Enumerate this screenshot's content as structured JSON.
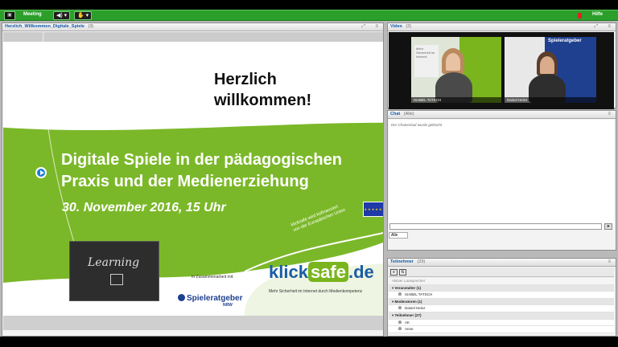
{
  "menubar": {
    "menu_label": "Meeting",
    "help_label": "Hilfe"
  },
  "presentation": {
    "title": "Herzlich_Willkommen_Digitale_Spiele",
    "count": "(3)",
    "slide": {
      "welcome_line1": "Herzlich",
      "welcome_line2": "willkommen!",
      "title_line1": "Digitale Spiele in der pädagogischen",
      "title_line2": "Praxis und der Medienerziehung",
      "date": "30. November 2016, 15 Uhr",
      "eu_line1": "klicksafe wird kofinanziert",
      "eu_line2": "von der Europäischen Union",
      "board_word": "Learning",
      "cooperation": "In Zusammenarbeit mit:",
      "partner_name": "Spieleratgeber",
      "partner_region": "NRW",
      "logo_klick": "klick",
      "logo_safe": "safe",
      "logo_de": ".de",
      "logo_tagline": "Mehr Sicherheit im Internet durch Medienkompetenz"
    }
  },
  "video": {
    "title": "Video",
    "count": "(2)",
    "feeds": [
      {
        "name": "ISABEL TATSCH"
      },
      {
        "name": "Daniel Heinz"
      }
    ],
    "banner_text": "Spieleratgeber"
  },
  "chat": {
    "title": "Chat",
    "scope": "(Alle)",
    "messages": [
      "Der Chatverlauf wurde gelöscht"
    ],
    "tab_label": "Alle"
  },
  "participants": {
    "title": "Teilnehmer",
    "count": "(29)",
    "hint": "Aktiver Lautsprecher",
    "groups": [
      {
        "label": "Veranstalter (1)",
        "users": [
          "ISABEL TATSCH"
        ]
      },
      {
        "label": "Moderatoren (1)",
        "users": [
          "Daniel Heinz"
        ]
      },
      {
        "label": "Teilnehmer (27)",
        "users": [
          "AK",
          "Anne"
        ]
      }
    ]
  }
}
